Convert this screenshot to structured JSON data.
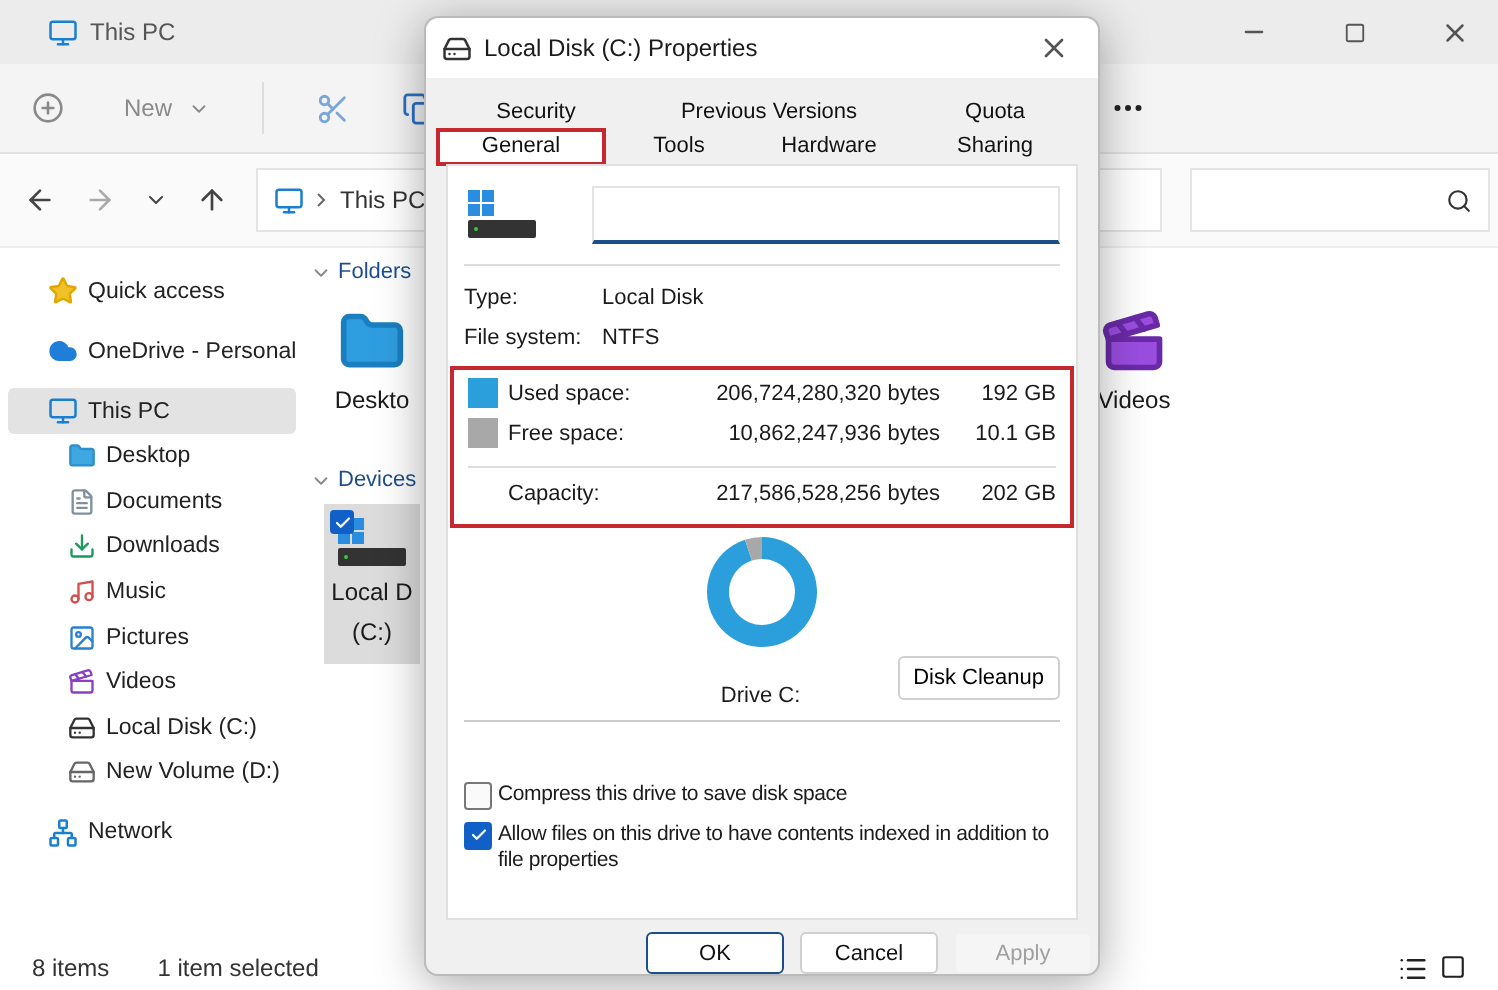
{
  "explorer": {
    "title": "This PC",
    "toolbar": {
      "new_label": "New"
    },
    "address": {
      "path": "This PC"
    },
    "nav": [
      {
        "label": "Quick access",
        "selected": false
      },
      {
        "label": "OneDrive - Personal",
        "selected": false
      },
      {
        "label": "This PC",
        "selected": true,
        "children": [
          {
            "label": "Desktop",
            "selected": false
          },
          {
            "label": "Documents",
            "selected": false
          },
          {
            "label": "Downloads",
            "selected": false
          },
          {
            "label": "Music",
            "selected": false
          },
          {
            "label": "Pictures",
            "selected": false
          },
          {
            "label": "Videos",
            "selected": false
          },
          {
            "label": "Local Disk (C:)",
            "selected": false
          },
          {
            "label": "New Volume (D:)",
            "selected": false
          }
        ]
      },
      {
        "label": "Network",
        "selected": false
      }
    ],
    "groups": [
      {
        "title": "Folders",
        "items": [
          {
            "lines": [
              "Deskto"
            ],
            "selected": false
          },
          {
            "lines": [
              "Videos"
            ],
            "selected": false
          }
        ]
      },
      {
        "title": "Devices",
        "items": [
          {
            "lines": [
              "Local D",
              "(C:)"
            ],
            "selected": true
          }
        ]
      }
    ],
    "status": {
      "count": "8 items",
      "selection": "1 item selected"
    }
  },
  "dialog": {
    "title": "Local Disk (C:) Properties",
    "tab_rows": [
      [
        {
          "label": "Security",
          "selected": false,
          "highlighted": false
        },
        {
          "label": "Previous Versions",
          "selected": false,
          "highlighted": false
        },
        {
          "label": "Quota",
          "selected": false,
          "highlighted": false
        }
      ],
      [
        {
          "label": "General",
          "selected": true,
          "highlighted": true
        },
        {
          "label": "Tools",
          "selected": false,
          "highlighted": false
        },
        {
          "label": "Hardware",
          "selected": false,
          "highlighted": false
        },
        {
          "label": "Sharing",
          "selected": false,
          "highlighted": false
        }
      ]
    ],
    "info": [
      {
        "label": "Type:",
        "value": "Local Disk"
      },
      {
        "label": "File system:",
        "value": "NTFS"
      }
    ],
    "space": {
      "highlighted": true,
      "rows": [
        {
          "kind": "used",
          "label": "Used space:",
          "bytes": "206,724,280,320 bytes",
          "size": "192 GB",
          "color": "#2b9fdc"
        },
        {
          "kind": "free",
          "label": "Free space:",
          "bytes": "10,862,247,936 bytes",
          "size": "10.1 GB",
          "color": "#a8a8a8"
        },
        {
          "kind": "total",
          "label": "Capacity:",
          "bytes": "217,586,528,256 bytes",
          "size": "202 GB"
        }
      ]
    },
    "drive_label": "Drive C:",
    "cleanup": "Disk Cleanup",
    "options": [
      {
        "label": "Compress this drive to save disk space",
        "checked": false
      },
      {
        "label": "Allow files on this drive to have contents indexed in addition to file properties",
        "checked": true
      }
    ],
    "buttons": [
      {
        "label": "OK",
        "default": true,
        "disabled": false
      },
      {
        "label": "Cancel",
        "default": false,
        "disabled": false
      },
      {
        "label": "Apply",
        "default": false,
        "disabled": true
      }
    ]
  }
}
